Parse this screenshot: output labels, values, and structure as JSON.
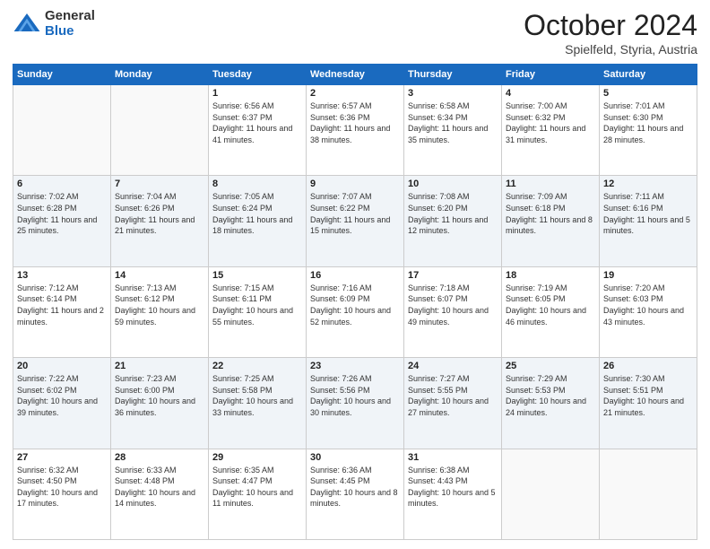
{
  "header": {
    "logo_general": "General",
    "logo_blue": "Blue",
    "title": "October 2024",
    "location": "Spielfeld, Styria, Austria"
  },
  "weekdays": [
    "Sunday",
    "Monday",
    "Tuesday",
    "Wednesday",
    "Thursday",
    "Friday",
    "Saturday"
  ],
  "weeks": [
    [
      {
        "day": "",
        "info": ""
      },
      {
        "day": "",
        "info": ""
      },
      {
        "day": "1",
        "info": "Sunrise: 6:56 AM\nSunset: 6:37 PM\nDaylight: 11 hours and 41 minutes."
      },
      {
        "day": "2",
        "info": "Sunrise: 6:57 AM\nSunset: 6:36 PM\nDaylight: 11 hours and 38 minutes."
      },
      {
        "day": "3",
        "info": "Sunrise: 6:58 AM\nSunset: 6:34 PM\nDaylight: 11 hours and 35 minutes."
      },
      {
        "day": "4",
        "info": "Sunrise: 7:00 AM\nSunset: 6:32 PM\nDaylight: 11 hours and 31 minutes."
      },
      {
        "day": "5",
        "info": "Sunrise: 7:01 AM\nSunset: 6:30 PM\nDaylight: 11 hours and 28 minutes."
      }
    ],
    [
      {
        "day": "6",
        "info": "Sunrise: 7:02 AM\nSunset: 6:28 PM\nDaylight: 11 hours and 25 minutes."
      },
      {
        "day": "7",
        "info": "Sunrise: 7:04 AM\nSunset: 6:26 PM\nDaylight: 11 hours and 21 minutes."
      },
      {
        "day": "8",
        "info": "Sunrise: 7:05 AM\nSunset: 6:24 PM\nDaylight: 11 hours and 18 minutes."
      },
      {
        "day": "9",
        "info": "Sunrise: 7:07 AM\nSunset: 6:22 PM\nDaylight: 11 hours and 15 minutes."
      },
      {
        "day": "10",
        "info": "Sunrise: 7:08 AM\nSunset: 6:20 PM\nDaylight: 11 hours and 12 minutes."
      },
      {
        "day": "11",
        "info": "Sunrise: 7:09 AM\nSunset: 6:18 PM\nDaylight: 11 hours and 8 minutes."
      },
      {
        "day": "12",
        "info": "Sunrise: 7:11 AM\nSunset: 6:16 PM\nDaylight: 11 hours and 5 minutes."
      }
    ],
    [
      {
        "day": "13",
        "info": "Sunrise: 7:12 AM\nSunset: 6:14 PM\nDaylight: 11 hours and 2 minutes."
      },
      {
        "day": "14",
        "info": "Sunrise: 7:13 AM\nSunset: 6:12 PM\nDaylight: 10 hours and 59 minutes."
      },
      {
        "day": "15",
        "info": "Sunrise: 7:15 AM\nSunset: 6:11 PM\nDaylight: 10 hours and 55 minutes."
      },
      {
        "day": "16",
        "info": "Sunrise: 7:16 AM\nSunset: 6:09 PM\nDaylight: 10 hours and 52 minutes."
      },
      {
        "day": "17",
        "info": "Sunrise: 7:18 AM\nSunset: 6:07 PM\nDaylight: 10 hours and 49 minutes."
      },
      {
        "day": "18",
        "info": "Sunrise: 7:19 AM\nSunset: 6:05 PM\nDaylight: 10 hours and 46 minutes."
      },
      {
        "day": "19",
        "info": "Sunrise: 7:20 AM\nSunset: 6:03 PM\nDaylight: 10 hours and 43 minutes."
      }
    ],
    [
      {
        "day": "20",
        "info": "Sunrise: 7:22 AM\nSunset: 6:02 PM\nDaylight: 10 hours and 39 minutes."
      },
      {
        "day": "21",
        "info": "Sunrise: 7:23 AM\nSunset: 6:00 PM\nDaylight: 10 hours and 36 minutes."
      },
      {
        "day": "22",
        "info": "Sunrise: 7:25 AM\nSunset: 5:58 PM\nDaylight: 10 hours and 33 minutes."
      },
      {
        "day": "23",
        "info": "Sunrise: 7:26 AM\nSunset: 5:56 PM\nDaylight: 10 hours and 30 minutes."
      },
      {
        "day": "24",
        "info": "Sunrise: 7:27 AM\nSunset: 5:55 PM\nDaylight: 10 hours and 27 minutes."
      },
      {
        "day": "25",
        "info": "Sunrise: 7:29 AM\nSunset: 5:53 PM\nDaylight: 10 hours and 24 minutes."
      },
      {
        "day": "26",
        "info": "Sunrise: 7:30 AM\nSunset: 5:51 PM\nDaylight: 10 hours and 21 minutes."
      }
    ],
    [
      {
        "day": "27",
        "info": "Sunrise: 6:32 AM\nSunset: 4:50 PM\nDaylight: 10 hours and 17 minutes."
      },
      {
        "day": "28",
        "info": "Sunrise: 6:33 AM\nSunset: 4:48 PM\nDaylight: 10 hours and 14 minutes."
      },
      {
        "day": "29",
        "info": "Sunrise: 6:35 AM\nSunset: 4:47 PM\nDaylight: 10 hours and 11 minutes."
      },
      {
        "day": "30",
        "info": "Sunrise: 6:36 AM\nSunset: 4:45 PM\nDaylight: 10 hours and 8 minutes."
      },
      {
        "day": "31",
        "info": "Sunrise: 6:38 AM\nSunset: 4:43 PM\nDaylight: 10 hours and 5 minutes."
      },
      {
        "day": "",
        "info": ""
      },
      {
        "day": "",
        "info": ""
      }
    ]
  ]
}
